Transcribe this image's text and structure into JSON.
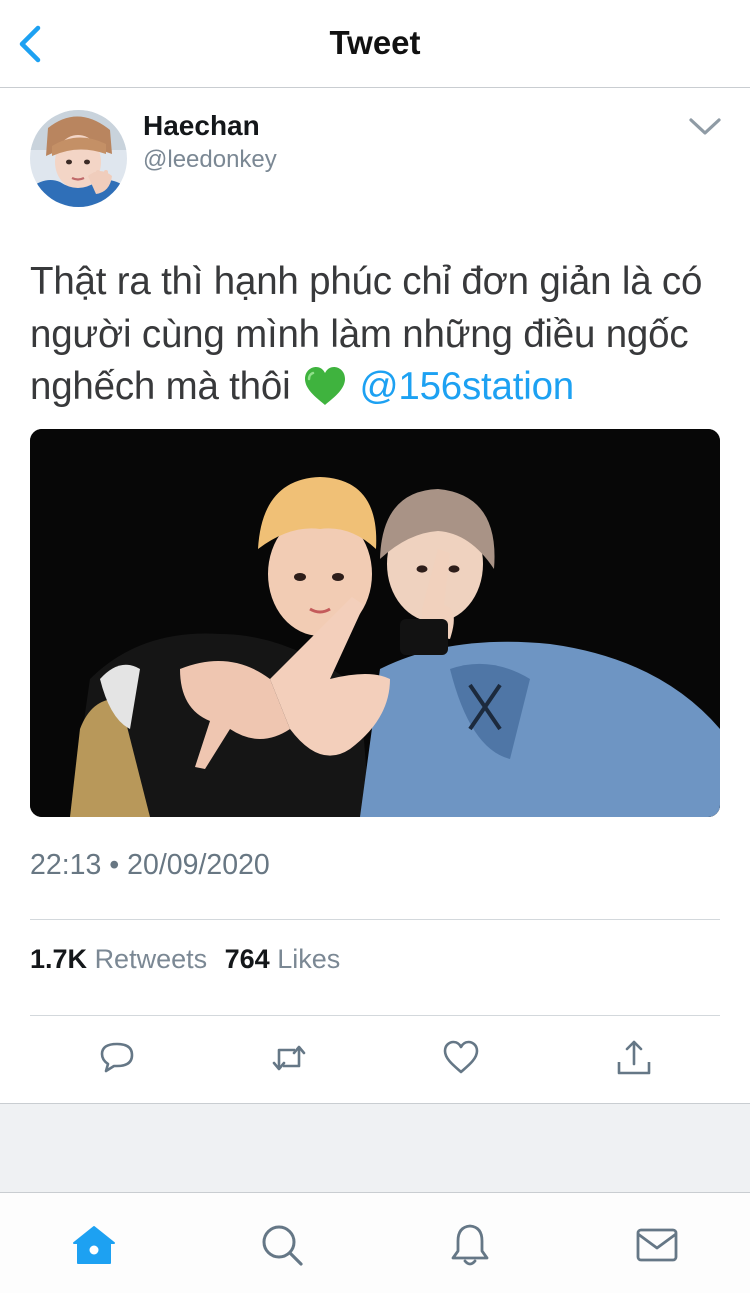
{
  "nav": {
    "title": "Tweet"
  },
  "tweet": {
    "author_name": "Haechan",
    "author_handle": "@leedonkey",
    "text_before_emoji": "Thật ra thì hạnh phúc chỉ đơn giản là có người cùng mình làm những điều ngốc nghếch mà thôi",
    "emoji": "green-heart",
    "mention": "@156station",
    "timestamp": "22:13 • 20/09/2020",
    "retweet_count": "1.7K",
    "retweet_label": "Retweets",
    "like_count": "764",
    "like_label": "Likes"
  },
  "colors": {
    "link": "#1da1f2",
    "text_secondary": "#687783",
    "heart_emoji": "#3fb33e",
    "tab_active": "#1da1f2",
    "tab_inactive": "#657786"
  },
  "icons": {
    "back": "chevron-left-icon",
    "more": "chevron-down-icon",
    "actions": [
      "reply-icon",
      "retweet-icon",
      "like-icon",
      "share-icon"
    ],
    "tabs": [
      "home-icon",
      "search-icon",
      "notifications-icon",
      "messages-icon"
    ]
  },
  "active_tab": "home"
}
